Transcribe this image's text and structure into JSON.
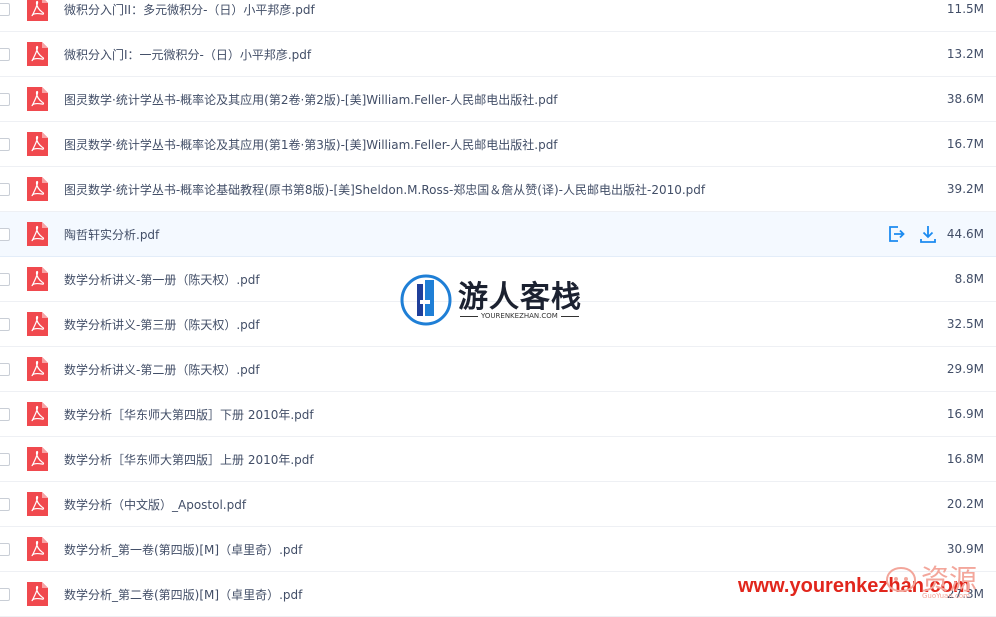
{
  "files": [
    {
      "name": "微积分入门II：多元微积分-（日）小平邦彦.pdf",
      "size": "11.5M"
    },
    {
      "name": "微积分入门I：一元微积分-（日）小平邦彦.pdf",
      "size": "13.2M"
    },
    {
      "name": "图灵数学·统计学丛书-概率论及其应用(第2卷·第2版)-[美]William.Feller-人民邮电出版社.pdf",
      "size": "38.6M"
    },
    {
      "name": "图灵数学·统计学丛书-概率论及其应用(第1卷·第3版)-[美]William.Feller-人民邮电出版社.pdf",
      "size": "16.7M"
    },
    {
      "name": "图灵数学·统计学丛书-概率论基础教程(原书第8版)-[美]Sheldon.M.Ross-郑忠国＆詹从赞(译)-人民邮电出版社-2010.pdf",
      "size": "39.2M"
    },
    {
      "name": "陶哲轩实分析.pdf",
      "size": "44.6M",
      "hover": true
    },
    {
      "name": "数学分析讲义-第一册（陈天权）.pdf",
      "size": "8.8M"
    },
    {
      "name": "数学分析讲义-第三册（陈天权）.pdf",
      "size": "32.5M"
    },
    {
      "name": "数学分析讲义-第二册（陈天权）.pdf",
      "size": "29.9M"
    },
    {
      "name": "数学分析［华东师大第四版］下册 2010年.pdf",
      "size": "16.9M"
    },
    {
      "name": "数学分析［华东师大第四版］上册 2010年.pdf",
      "size": "16.8M"
    },
    {
      "name": "数学分析（中文版）_Apostol.pdf",
      "size": "20.2M"
    },
    {
      "name": "数学分析_第一卷(第四版)[M]（卓里奇）.pdf",
      "size": "30.9M"
    },
    {
      "name": "数学分析_第二卷(第四版)[M]（卓里奇）.pdf",
      "size": "27.3M"
    }
  ],
  "row_actions": {
    "share_icon": "share-icon",
    "download_icon": "download-icon"
  },
  "watermark": {
    "title": "游人客栈",
    "subtitle": "YOURENKEZHAN.COM",
    "url": "www.yourenkezhan.com",
    "badge_text": "资源",
    "badge_small": "GuoYuan.com"
  },
  "colors": {
    "pdf_red": "#f0494e",
    "action_blue": "#1c8bf0",
    "text": "#424e67",
    "hover_bg": "#f4f9ff"
  }
}
